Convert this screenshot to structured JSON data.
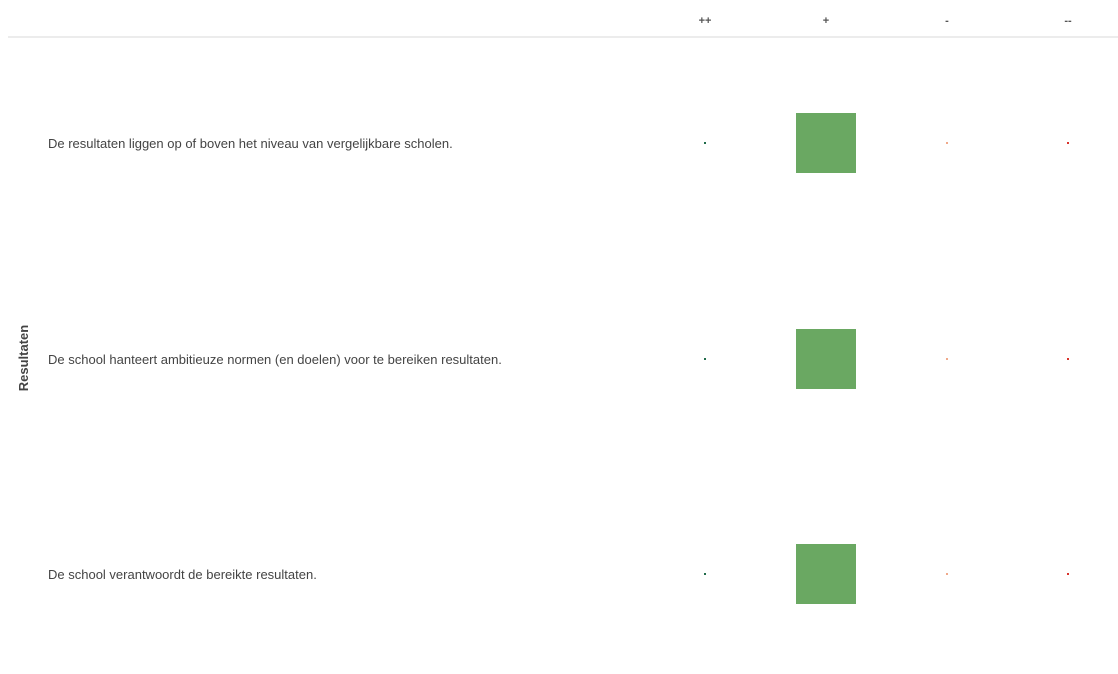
{
  "chart_data": {
    "type": "heatmap",
    "group_label": "Resultaten",
    "columns": [
      "++",
      "+",
      "-",
      "--"
    ],
    "column_colors": [
      "#1f6b4a",
      "#6aa862",
      "#f0a98a",
      "#d9322b"
    ],
    "rows": [
      {
        "label": "De resultaten liggen op of boven het niveau van vergelijkbare scholen.",
        "values": [
          0,
          1,
          0,
          0
        ]
      },
      {
        "label": "De school hanteert ambitieuze normen (en doelen) voor te bereiken resultaten.",
        "values": [
          0,
          1,
          0,
          0
        ]
      },
      {
        "label": "De school verantwoordt de bereikte resultaten.",
        "values": [
          0,
          1,
          0,
          0
        ]
      }
    ],
    "legend": "none",
    "grid": false
  }
}
